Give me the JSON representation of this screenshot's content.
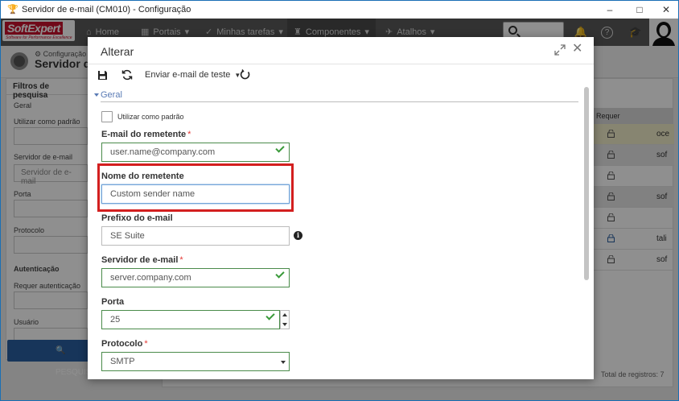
{
  "window": {
    "title": "Servidor de e-mail (CM010) - Configuração"
  },
  "nav": {
    "logo_text": "SoftExpert",
    "logo_tagline": "Software for Performance Excellence",
    "items": [
      {
        "label": "Home",
        "icon": "home-icon"
      },
      {
        "label": "Portais",
        "icon": "grid-icon"
      },
      {
        "label": "Minhas tarefas",
        "icon": "check-icon"
      },
      {
        "label": "Componentes",
        "icon": "trophy-icon"
      },
      {
        "label": "Atalhos",
        "icon": "rocket-icon"
      }
    ]
  },
  "page": {
    "breadcrumb": "Configuração",
    "title": "Servidor de e-mail"
  },
  "filters": {
    "header": "Filtros de pesquisa",
    "general": "Geral",
    "use_default": "Utilizar como padrão",
    "server_label": "Servidor de e-mail",
    "server_placeholder": "Servidor de e-mail",
    "port_label": "Porta",
    "protocol_label": "Protocolo",
    "auth_header": "Autenticação",
    "require_auth": "Requer autenticação",
    "user": "Usuário",
    "search_button": "PESQUISAR"
  },
  "grid": {
    "column_header": "Requer autenticação",
    "rows": [
      "oce",
      "sof",
      "",
      "sof",
      "",
      "tali",
      "sof"
    ],
    "total": "Total de registros: 7"
  },
  "modal": {
    "title": "Alterar",
    "toolbar": {
      "send_test": "Enviar e-mail de teste"
    },
    "section": "Geral",
    "use_default_label": "Utilizar como padrão",
    "sender_email_label": "E-mail do remetente",
    "sender_email_value": "user.name@company.com",
    "sender_name_label": "Nome do remetente",
    "sender_name_value": "Custom sender name",
    "prefix_label": "Prefixo do e-mail",
    "prefix_value": "SE Suite",
    "server_label": "Servidor de e-mail",
    "server_value": "server.company.com",
    "port_label": "Porta",
    "port_value": "25",
    "protocol_label": "Protocolo",
    "protocol_value": "SMTP",
    "required_mark": "*"
  },
  "colors": {
    "accent": "#5a7bb5",
    "highlight": "#d31f1f",
    "valid": "#3a9a3a",
    "required": "#e53935"
  }
}
